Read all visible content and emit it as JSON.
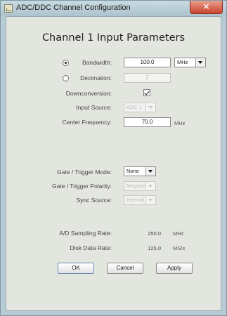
{
  "window": {
    "title": "ADC/DDC Channel Configuration",
    "close_glyph": "×",
    "icon": "app-window-icon"
  },
  "heading": "Channel 1 Input Parameters",
  "bandwidth": {
    "label": "Bandwidth:",
    "selected": true,
    "value": "100.0",
    "unit": "MHz"
  },
  "decimation": {
    "label": "Decimation:",
    "selected": false,
    "value": "2"
  },
  "downconversion": {
    "label": "Downconversion:",
    "checked": true
  },
  "input_source": {
    "label": "Input Source:",
    "value": "ADC 1"
  },
  "center_frequency": {
    "label": "Center Frequency:",
    "value": "70.0",
    "unit": "MHz"
  },
  "gate_trigger_mode": {
    "label": "Gate / Trigger Mode:",
    "value": "None"
  },
  "gate_trigger_polarity": {
    "label": "Gate / Trigger Polarity:",
    "value": "Negative"
  },
  "sync_source": {
    "label": "Sync Source:",
    "value": "Internal"
  },
  "ad_sampling_rate": {
    "label": "A/D Sampling Rate:",
    "value": "250.0",
    "unit": "MHz"
  },
  "disk_data_rate": {
    "label": "Disk Data Rate:",
    "value": "125.0",
    "unit": "MS/s"
  },
  "buttons": {
    "ok": "OK",
    "cancel": "Cancel",
    "apply": "Apply"
  },
  "colors": {
    "frame": "#b7cbd3",
    "client": "#e3e6df",
    "close": "#c9442d"
  }
}
